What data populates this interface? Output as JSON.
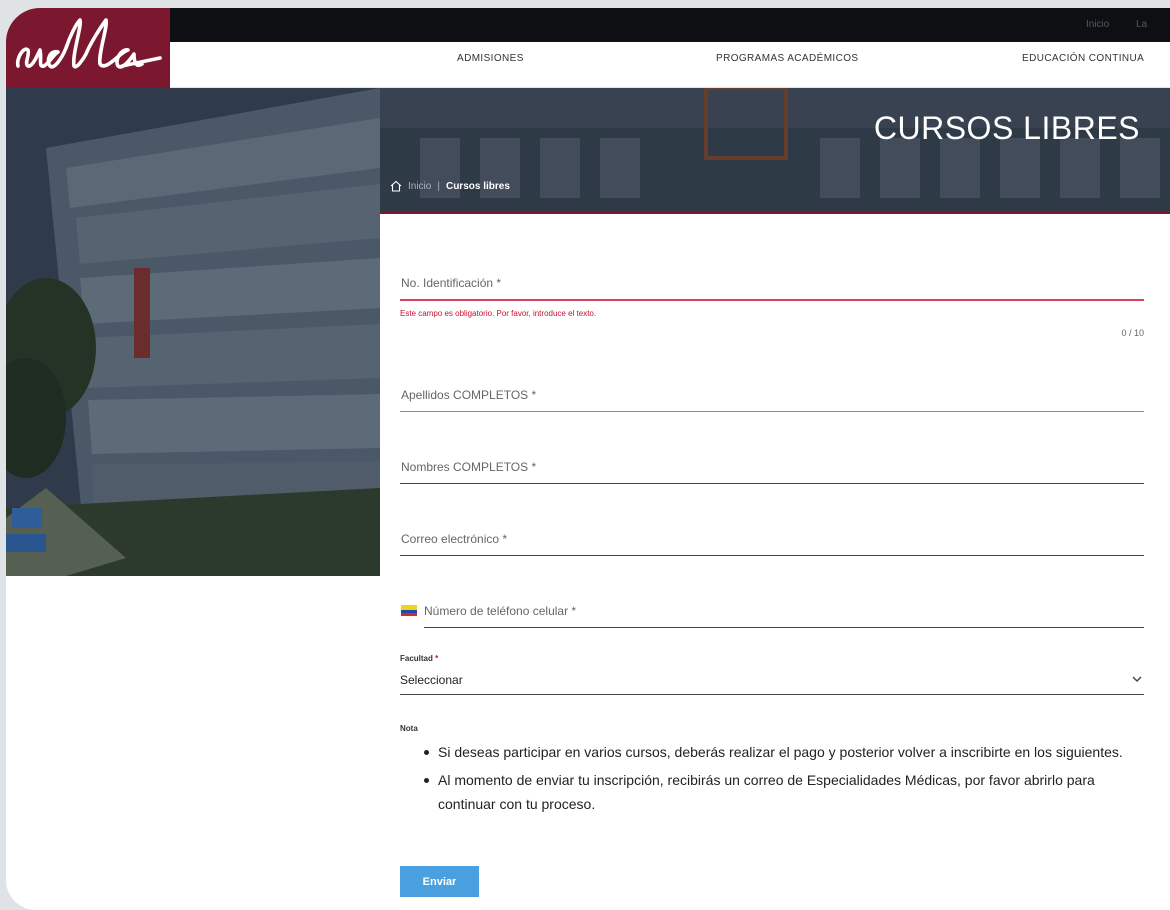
{
  "header": {
    "logo_text": "udla",
    "top_links": [
      "Inicio",
      "La"
    ],
    "nav": [
      "ADMISIONES",
      "PROGRAMAS ACADÉMICOS",
      "EDUCACIÓN CONTINUA"
    ]
  },
  "hero": {
    "title": "CURSOS LIBRES",
    "breadcrumb": {
      "home": "Inicio",
      "separator": "|",
      "current": "Cursos libres"
    }
  },
  "form": {
    "identification": {
      "label": "No. Identificación *",
      "error": "Este campo es obligatorio. Por favor, introduce el texto.",
      "counter": "0 / 10"
    },
    "surnames": {
      "label": "Apellidos COMPLETOS *"
    },
    "names": {
      "label": "Nombres COMPLETOS *"
    },
    "email": {
      "label": "Correo electrónico *"
    },
    "phone": {
      "label": "Número de teléfono celular *",
      "flag_icon": "ecuador-flag-icon"
    },
    "faculty": {
      "label": "Facultad",
      "required_mark": "*",
      "value": "Seleccionar"
    },
    "note": {
      "label": "Nota",
      "items": [
        "Si deseas participar en varios cursos, deberás realizar el pago y posterior volver a inscribirte en los siguientes.",
        "Al momento de enviar tu inscripción, recibirás un correo de Especialidades Médicas, por favor abrirlo para continuar con tu proceso."
      ]
    },
    "submit_label": "Enviar"
  },
  "colors": {
    "brand": "#7b1830",
    "error": "#c8102e",
    "focus": "#4a9fde",
    "button": "#4a9fde"
  }
}
